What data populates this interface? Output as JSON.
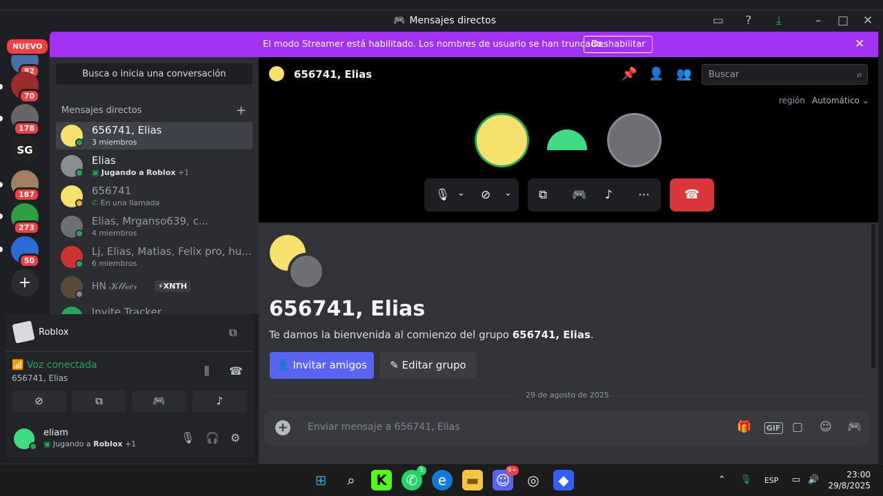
{
  "window": {
    "title": "Mensajes directos"
  },
  "banner": {
    "message": "El modo Streamer está habilitado. Los nombres de usuario se han truncado.",
    "button": "Deshabilitar"
  },
  "guilds": {
    "new_label": "NUEVO",
    "badges": [
      "82",
      "70",
      "178",
      "187",
      "273",
      "50"
    ]
  },
  "dm_sidebar": {
    "search_label": "Busca o inicia una conversación",
    "header": "Mensajes directos",
    "items": [
      {
        "name": "656741, Elias",
        "sub": "3 miembros"
      },
      {
        "name": "Elias",
        "sub_prefix": "Jugando a",
        "sub_game": "Roblox",
        "sub_suffix": "+1"
      },
      {
        "name": "656741",
        "sub": "En una llamada"
      },
      {
        "name": "Elias, Mrganso639, c...",
        "sub": "4 miembros"
      },
      {
        "name": "Lj, Elias, Matias, Felix pro, hu...",
        "sub": "6 miembros"
      },
      {
        "name": "HN 𝒦𝓁𝓁𝓋𝑒𝓇",
        "tag": "XNTH"
      },
      {
        "name": "Invite Tracker"
      }
    ]
  },
  "activity": {
    "game": "Roblox"
  },
  "voice": {
    "status": "Voz conectada",
    "channel": "656741, Elias"
  },
  "user": {
    "name": "eliam",
    "status_prefix": "Jugando a",
    "status_game": "Roblox",
    "status_suffix": "+1"
  },
  "call": {
    "title": "656741, Elias",
    "search_placeholder": "Buscar",
    "region_label": "región",
    "region_value": "Automático"
  },
  "welcome": {
    "title": "656741, Elias",
    "text_prefix": "Te damos la bienvenida al comienzo del grupo ",
    "text_bold": "656741, Elias",
    "text_suffix": ".",
    "invite_button": "Invitar amigos",
    "edit_button": "Editar grupo"
  },
  "divider_date": "29 de agosto de 2025",
  "composer": {
    "placeholder": "Enviar mensaje a 656741, Elias"
  },
  "taskbar": {
    "lang": "ESP",
    "time": "23:00",
    "date": "29/8/2025",
    "whatsapp_badge": "5",
    "discord_badge": "9+"
  },
  "colors": {
    "brand": "#5865f2",
    "banner": "#a231f2",
    "online": "#23a55a",
    "danger": "#da373c"
  }
}
